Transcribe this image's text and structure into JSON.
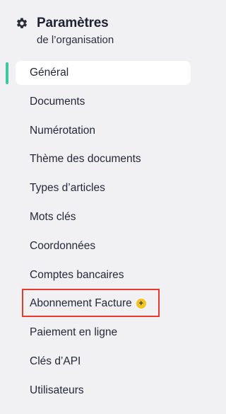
{
  "header": {
    "title": "Paramètres",
    "subtitle": "de l’organisation",
    "icon": "gear-icon"
  },
  "nav": {
    "items": [
      {
        "label": "Général",
        "active": true
      },
      {
        "label": "Documents"
      },
      {
        "label": "Numérotation"
      },
      {
        "label": "Thème des documents"
      },
      {
        "label": "Types d’articles"
      },
      {
        "label": "Mots clés"
      },
      {
        "label": "Coordonnées"
      },
      {
        "label": "Comptes bancaires"
      },
      {
        "label": "Abonnement Facture",
        "badge": "+",
        "badge_icon": "plus-badge-icon",
        "highlighted": true
      },
      {
        "label": "Paiement en ligne"
      },
      {
        "label": "Clés d’API"
      },
      {
        "label": "Utilisateurs"
      }
    ]
  },
  "colors": {
    "background": "#f1f1f4",
    "active_item_bg": "#ffffff",
    "active_bar": "#3fc7a0",
    "highlight_border": "#e83b2e",
    "badge": "#f2c51c",
    "text": "#252838"
  }
}
